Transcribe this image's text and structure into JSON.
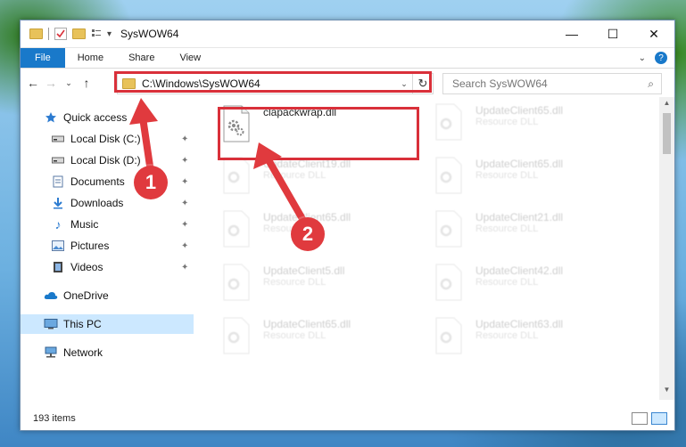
{
  "window": {
    "title": "SysWOW64",
    "controls": [
      "—",
      "☐",
      "✕"
    ]
  },
  "ribbon": {
    "tabs": [
      "File",
      "Home",
      "Share",
      "View"
    ],
    "help": "?"
  },
  "nav": {
    "address": "C:\\Windows\\SysWOW64",
    "search_placeholder": "Search SysWOW64"
  },
  "sidebar": {
    "items": [
      {
        "label": "Quick access",
        "icon": "star-icon"
      },
      {
        "label": "Local Disk (C:)",
        "icon": "drive-icon",
        "pinned": true
      },
      {
        "label": "Local Disk (D:)",
        "icon": "drive-icon",
        "pinned": true
      },
      {
        "label": "Documents",
        "icon": "documents-icon",
        "pinned": true
      },
      {
        "label": "Downloads",
        "icon": "download-icon",
        "pinned": true
      },
      {
        "label": "Music",
        "icon": "music-icon",
        "pinned": true
      },
      {
        "label": "Pictures",
        "icon": "pictures-icon",
        "pinned": true
      },
      {
        "label": "Videos",
        "icon": "videos-icon",
        "pinned": true
      },
      {
        "label": "OneDrive",
        "icon": "cloud-icon"
      },
      {
        "label": "This PC",
        "icon": "computer-icon",
        "selected": true
      },
      {
        "label": "Network",
        "icon": "network-icon"
      }
    ]
  },
  "files": {
    "highlighted": {
      "name": "clapackwrap.dll",
      "type": ""
    },
    "left_column": [
      {
        "name": "UpdateClient19.dll",
        "type": "Resource DLL"
      },
      {
        "name": "UpdateClient65.dll",
        "type": "Resource DLL"
      },
      {
        "name": "UpdateClient5.dll",
        "type": "Resource DLL"
      },
      {
        "name": "UpdateClient65.dll",
        "type": "Resource DLL"
      }
    ],
    "right_column": [
      {
        "name": "UpdateClient65.dll",
        "type": "Resource DLL"
      },
      {
        "name": "UpdateClient65.dll",
        "type": "Resource DLL"
      },
      {
        "name": "UpdateClient21.dll",
        "type": "Resource DLL"
      },
      {
        "name": "UpdateClient42.dll",
        "type": "Resource DLL"
      },
      {
        "name": "UpdateClient63.dll",
        "type": "Resource DLL"
      }
    ]
  },
  "status": {
    "item_count": "193 items"
  },
  "annotations": {
    "badge1": "1",
    "badge2": "2"
  },
  "colors": {
    "accent": "#1979ca",
    "highlight_red": "#d9303a",
    "selection": "#cce8ff"
  }
}
